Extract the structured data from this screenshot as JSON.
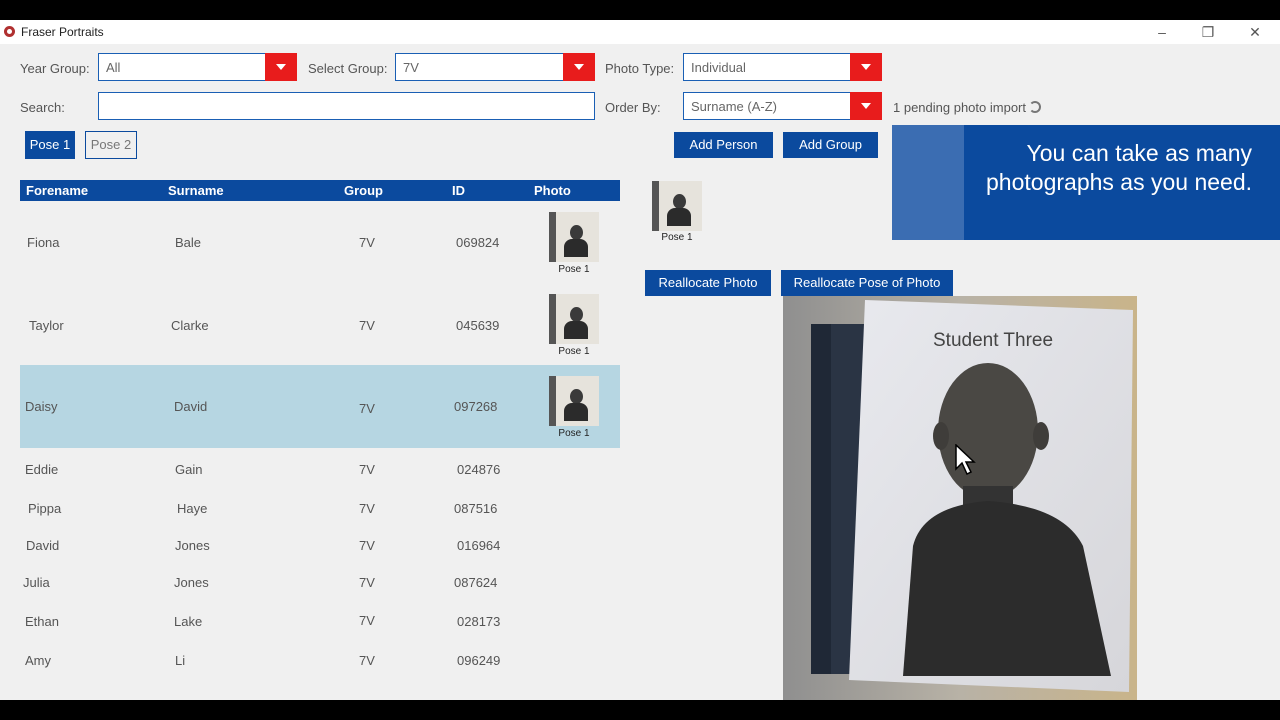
{
  "app": {
    "title": "Fraser Portraits"
  },
  "filters": {
    "year_group_label": "Year Group:",
    "year_group_value": "All",
    "select_group_label": "Select Group:",
    "select_group_value": "7V",
    "photo_type_label": "Photo Type:",
    "photo_type_value": "Individual",
    "search_label": "Search:",
    "search_value": "",
    "order_by_label": "Order By:",
    "order_by_value": "Surname (A-Z)"
  },
  "status": {
    "pending": "1 pending photo import"
  },
  "pose_tabs": [
    {
      "label": "Pose 1"
    },
    {
      "label": "Pose 2"
    }
  ],
  "buttons": {
    "add_person": "Add Person",
    "add_group": "Add Group",
    "reallocate_photo": "Reallocate Photo",
    "reallocate_pose": "Reallocate Pose of Photo"
  },
  "table": {
    "headers": {
      "forename": "Forename",
      "surname": "Surname",
      "group": "Group",
      "id": "ID",
      "photo": "Photo"
    },
    "rows": [
      {
        "forename": "Fiona",
        "surname": "Bale",
        "group": "7V",
        "id": "069824",
        "photo_label": "Pose 1"
      },
      {
        "forename": "Taylor",
        "surname": "Clarke",
        "group": "7V",
        "id": "045639",
        "photo_label": "Pose 1"
      },
      {
        "forename": "Daisy",
        "surname": "David",
        "group": "7V",
        "id": "097268",
        "photo_label": "Pose 1",
        "selected": true
      },
      {
        "forename": "Eddie",
        "surname": "Gain",
        "group": "7V",
        "id": "024876"
      },
      {
        "forename": "Pippa",
        "surname": "Haye",
        "group": "7V",
        "id": "087516"
      },
      {
        "forename": "David",
        "surname": "Jones",
        "group": "7V",
        "id": "016964"
      },
      {
        "forename": "Julia",
        "surname": "Jones",
        "group": "7V",
        "id": "087624"
      },
      {
        "forename": "Ethan",
        "surname": "Lake",
        "group": "7V",
        "id": "028173"
      },
      {
        "forename": "Amy",
        "surname": "Li",
        "group": "7V",
        "id": "096249"
      }
    ]
  },
  "selected_photos": [
    {
      "label": "Pose 1"
    }
  ],
  "preview": {
    "sign_text": "Student Three"
  },
  "overlay": {
    "text": "You can take as many photographs as you need."
  },
  "colors": {
    "accent": "#0b4a9e",
    "dropdown": "#e81c1c",
    "selected_row": "#b6d6e2"
  }
}
